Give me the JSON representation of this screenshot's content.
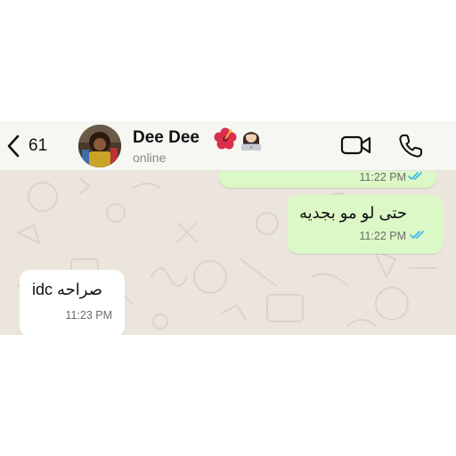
{
  "header": {
    "back_count": "61",
    "contact_name": "Dee Dee",
    "status": "online",
    "icons": {
      "back": "chevron-left-icon",
      "avatar": "contact-avatar",
      "flower": "hibiscus-emoji",
      "person": "technologist-emoji",
      "video": "video-camera-icon",
      "call": "phone-icon"
    }
  },
  "messages": [
    {
      "direction": "outgoing",
      "text": "",
      "time": "11:22 PM",
      "status": "read"
    },
    {
      "direction": "outgoing",
      "text": "حتى لو مو بجديه",
      "time": "11:22 PM",
      "status": "read"
    },
    {
      "direction": "incoming",
      "text": "صراحه idc",
      "time": "11:23 PM"
    }
  ],
  "colors": {
    "header_bg": "#f6f6f3",
    "chat_bg": "#ece5dd",
    "outgoing_bubble": "#dbf8c6",
    "incoming_bubble": "#ffffff",
    "read_ticks": "#34b7f1",
    "icon": "#111111"
  }
}
